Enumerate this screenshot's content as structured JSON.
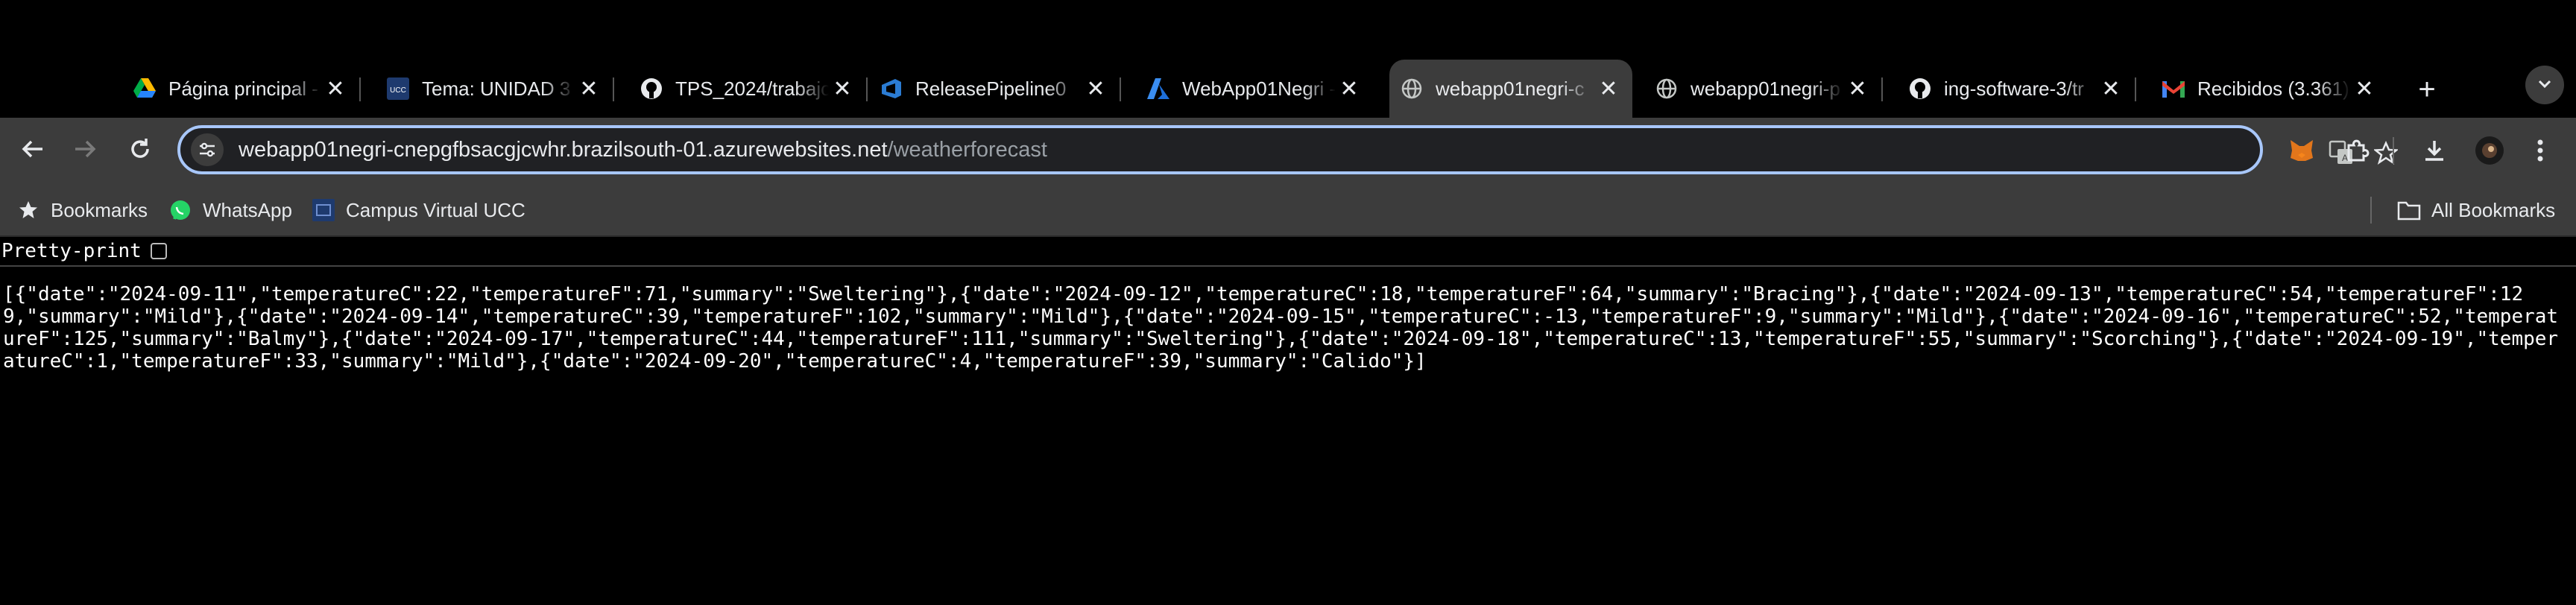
{
  "tabs": [
    {
      "title": "Página principal -",
      "icon": "google-drive-icon"
    },
    {
      "title": "Tema: UNIDAD 3",
      "icon": "ucc-icon"
    },
    {
      "title": "TPS_2024/trabajo",
      "icon": "github-icon"
    },
    {
      "title": "ReleasePipeline0",
      "icon": "azure-devops-icon"
    },
    {
      "title": "WebApp01Negri -",
      "icon": "azure-icon"
    },
    {
      "title": "webapp01negri-c",
      "icon": "globe-icon",
      "active": true
    },
    {
      "title": "webapp01negri-p",
      "icon": "globe-icon"
    },
    {
      "title": "ing-software-3/tr",
      "icon": "github-icon"
    },
    {
      "title": "Recibidos (3.361)",
      "icon": "gmail-icon"
    }
  ],
  "toolbar": {
    "url_host": "webapp01negri-cnepgfbsacgjcwhr.brazilsouth-01.azurewebsites.net",
    "url_path": "/weatherforecast"
  },
  "bookmarks": {
    "items": [
      {
        "label": "Bookmarks",
        "icon": "star-icon"
      },
      {
        "label": "WhatsApp",
        "icon": "whatsapp-icon"
      },
      {
        "label": "Campus Virtual UCC",
        "icon": "ucc-icon"
      }
    ],
    "all_label": "All Bookmarks"
  },
  "page": {
    "pretty_print_label": "Pretty-print",
    "pretty_print_checked": false,
    "json_text": "[{\"date\":\"2024-09-11\",\"temperatureC\":22,\"temperatureF\":71,\"summary\":\"Sweltering\"},{\"date\":\"2024-09-12\",\"temperatureC\":18,\"temperatureF\":64,\"summary\":\"Bracing\"},{\"date\":\"2024-09-13\",\"temperatureC\":54,\"temperatureF\":129,\"summary\":\"Mild\"},{\"date\":\"2024-09-14\",\"temperatureC\":39,\"temperatureF\":102,\"summary\":\"Mild\"},{\"date\":\"2024-09-15\",\"temperatureC\":-13,\"temperatureF\":9,\"summary\":\"Mild\"},{\"date\":\"2024-09-16\",\"temperatureC\":52,\"temperatureF\":125,\"summary\":\"Balmy\"},{\"date\":\"2024-09-17\",\"temperatureC\":44,\"temperatureF\":111,\"summary\":\"Sweltering\"},{\"date\":\"2024-09-18\",\"temperatureC\":13,\"temperatureF\":55,\"summary\":\"Scorching\"},{\"date\":\"2024-09-19\",\"temperatureC\":1,\"temperatureF\":33,\"summary\":\"Mild\"},{\"date\":\"2024-09-20\",\"temperatureC\":4,\"temperatureF\":39,\"summary\":\"Calido\"}]"
  },
  "colors": {
    "frame": "#000000",
    "toolbar": "#3c3c3c",
    "omnibox_border": "#a8c7fa",
    "text": "#e8eaed",
    "url_path": "#9aa0a6"
  }
}
